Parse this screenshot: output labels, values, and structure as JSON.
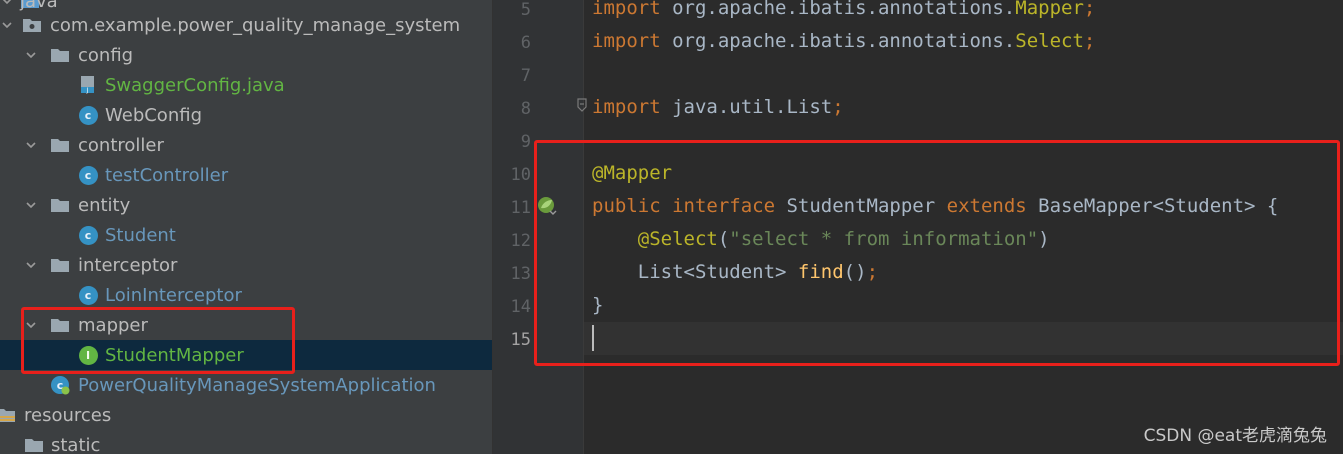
{
  "project_tree": {
    "items": [
      {
        "label": "java",
        "kind": "folder-root"
      },
      {
        "label": "com.example.power_quality_manage_system",
        "kind": "package"
      },
      {
        "label": "config",
        "kind": "folder"
      },
      {
        "label": "SwaggerConfig.java",
        "kind": "java-file"
      },
      {
        "label": "WebConfig",
        "kind": "class"
      },
      {
        "label": "controller",
        "kind": "folder"
      },
      {
        "label": "testController",
        "kind": "class"
      },
      {
        "label": "entity",
        "kind": "folder"
      },
      {
        "label": "Student",
        "kind": "class"
      },
      {
        "label": "interceptor",
        "kind": "folder"
      },
      {
        "label": "LoinInterceptor",
        "kind": "class"
      },
      {
        "label": "mapper",
        "kind": "folder"
      },
      {
        "label": "StudentMapper",
        "kind": "interface"
      },
      {
        "label": "PowerQualityManageSystemApplication",
        "kind": "spring-class"
      },
      {
        "label": "resources",
        "kind": "resource-folder"
      },
      {
        "label": "static",
        "kind": "folder"
      }
    ],
    "selected": "StudentMapper",
    "colors": {
      "modified_file": "#62b543",
      "class_label": "#6897bb",
      "default_label": "#bbbbbb",
      "selection": "#0d293e"
    }
  },
  "editor": {
    "line_numbers": [
      "5",
      "6",
      "7",
      "8",
      "9",
      "10",
      "11",
      "12",
      "13",
      "14",
      "15"
    ],
    "current_line": "15",
    "lines": [
      {
        "t0": "import ",
        "t1": "org.apache.ibatis.annotations.",
        "t2": "Mapper",
        "t3": ";"
      },
      {
        "t0": "import ",
        "t1": "org.apache.ibatis.annotations.",
        "t2": "Select",
        "t3": ";"
      },
      {},
      {
        "t0": "import ",
        "t1": "java.util.List",
        "t3": ";"
      },
      {},
      {
        "t0": "@Mapper"
      },
      {
        "t0": "public ",
        "t1": "interface ",
        "t2": "StudentMapper ",
        "t3": "extends ",
        "t4": "BaseMapper<Student> {"
      },
      {
        "t0": "    ",
        "t1": "@Select",
        "t2": "(",
        "t3": "\"select * from information\"",
        "t4": ")"
      },
      {
        "t0": "    List<Student> ",
        "t1": "find",
        "t2": "()",
        "t3": ";"
      },
      {
        "t0": "}"
      },
      {}
    ],
    "gutter_icons": [
      "fold-marker",
      "spring-bean-icon"
    ]
  },
  "highlight_color": "#e8201b",
  "watermark": "CSDN @eat老虎滴兔兔"
}
